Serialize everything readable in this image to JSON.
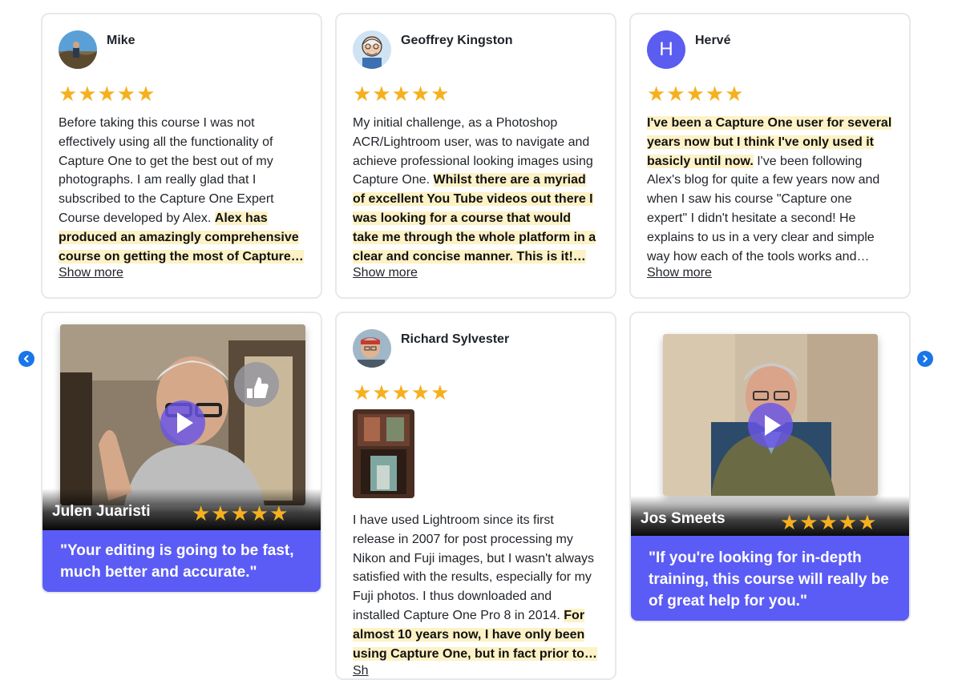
{
  "nav": {
    "prev_icon": "chevron-left-icon",
    "next_icon": "chevron-right-icon",
    "color": "#1976e8"
  },
  "colors": {
    "star": "#f6b01e",
    "quote_bg": "#5b5cf5",
    "highlight_bg": "#fdf2c6",
    "avatar_letter_bg": "#5b5cf0"
  },
  "stars_text": "★★★★★",
  "show_more_label": "Show more",
  "reviews": [
    {
      "name": "Mike",
      "rating": 5,
      "text_before": "Before taking this course I was not effectively using all the functionality of Capture One to get the best out of my photographs. I am really glad that I subscribed to the Capture One Expert Course developed by Alex. ",
      "highlight": "Alex has produced an amazingly comprehensive course on getting the most of Capture…",
      "text_after": ""
    },
    {
      "name": "Geoffrey Kingston",
      "rating": 5,
      "text_before": "My initial challenge, as a Photoshop ACR/Lightroom user, was to navigate and achieve professional looking images using Capture One. ",
      "highlight": "Whilst there are a myriad of excellent You Tube videos out there I was looking for a course that would take me through the whole platform in a clear and concise manner. This is it!…",
      "text_after": ""
    },
    {
      "name": "Hervé",
      "avatar_letter": "H",
      "rating": 5,
      "text_before": "",
      "highlight": "I've been a Capture One user for several years now but I think I've only used it basicly until now.",
      "text_after": " I've been following Alex's blog for quite a few years now and when I saw his course \"Capture one expert\" I didn't hesitate a second! He explains to us in a very clear and simple way how each of the tools works and…"
    },
    {
      "name": "Richard Sylvester",
      "rating": 5,
      "text_before": "I have used Lightroom since its first release in 2007 for post processing my Nikon and Fuji images, but I wasn't always satisfied with the results, especially for my Fuji photos. I thus downloaded and installed Capture One Pro 8 in 2014. ",
      "highlight": "For almost 10 years now, I have only been using Capture One, but in fact prior to…",
      "text_after": "",
      "show_more_label": "Sh"
    }
  ],
  "videos": [
    {
      "name": "Julen Juaristi",
      "rating": 5,
      "quote": "\"Your editing is going to be fast, much better and accurate.\""
    },
    {
      "name": "Jos Smeets",
      "rating": 5,
      "quote": "\"If you're looking for in-depth training, this course will really be of great help for you.\""
    }
  ]
}
